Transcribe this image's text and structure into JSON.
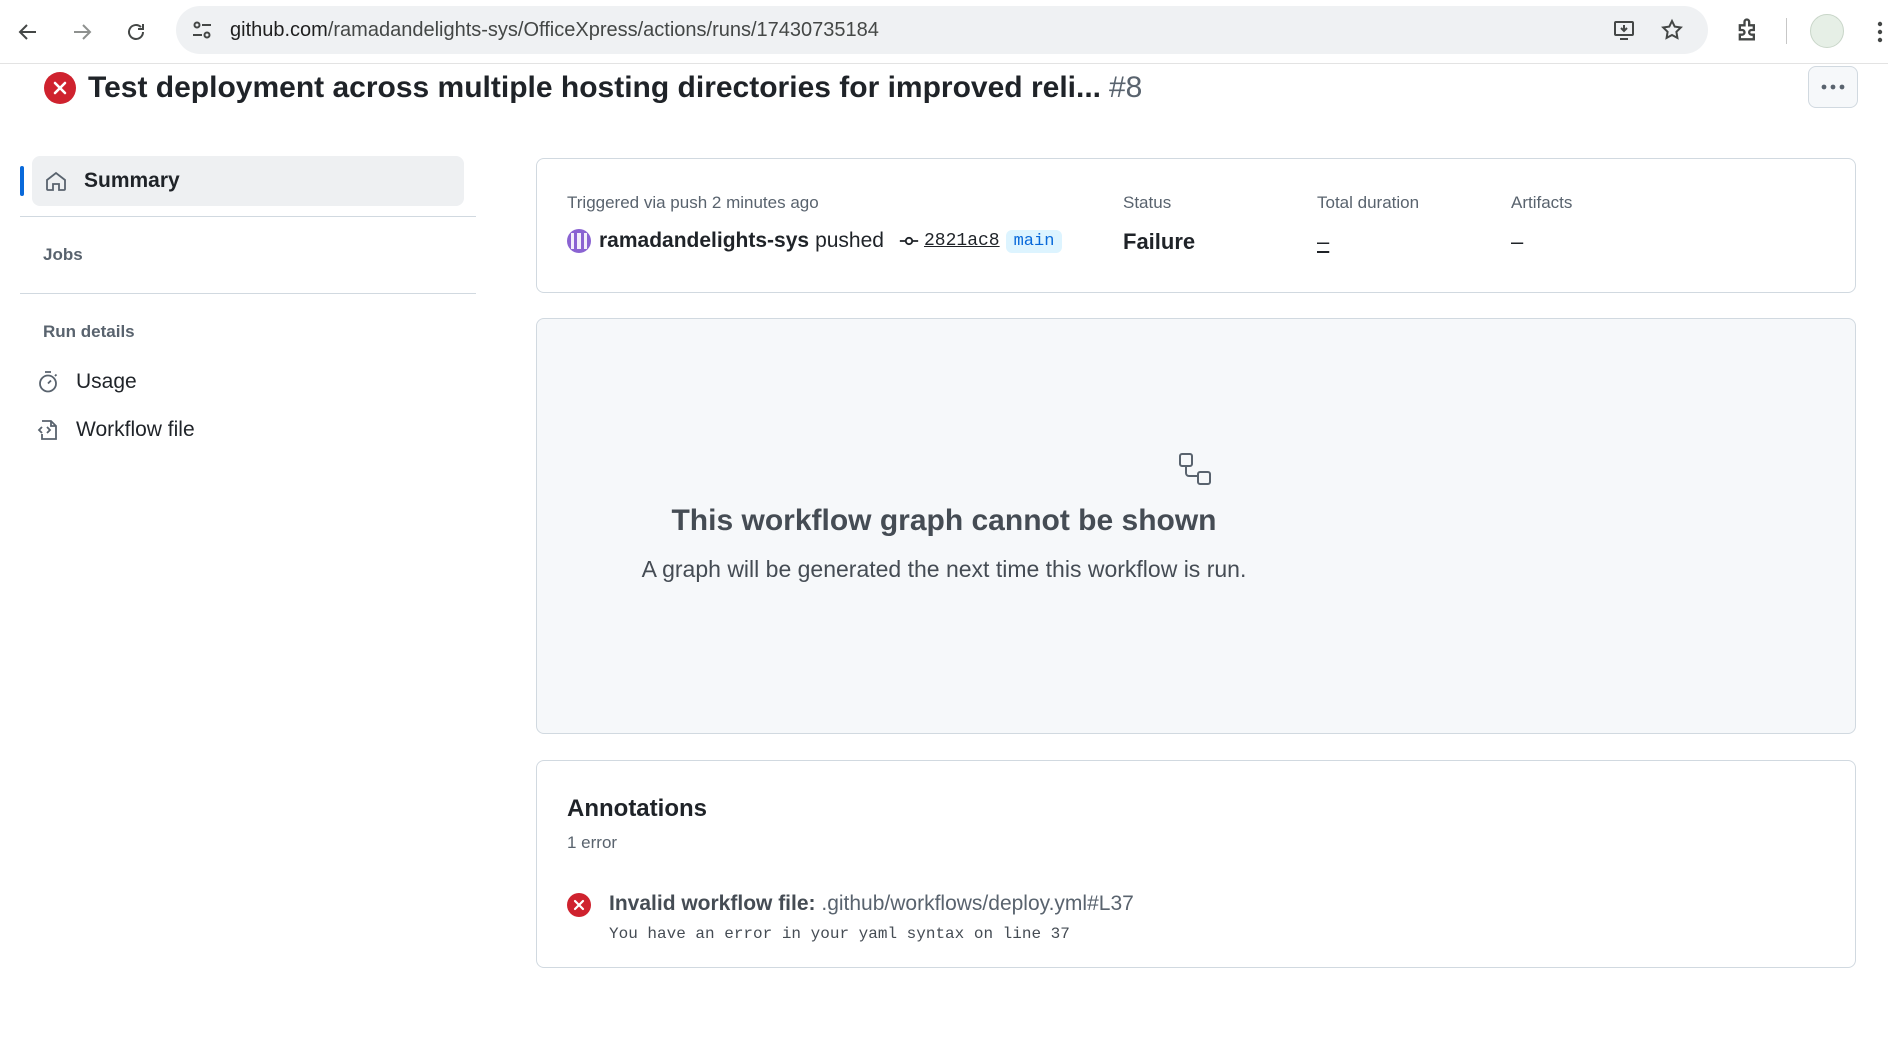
{
  "browser": {
    "url_host": "github.com",
    "url_path": "/ramadandelights-sys/OfficeXpress/actions/runs/17430735184"
  },
  "run": {
    "title": "Test deployment across multiple hosting directories for improved reli...",
    "number": "#8",
    "status_color": "#cf222e"
  },
  "sidebar": {
    "summary_label": "Summary",
    "jobs_section": "Jobs",
    "run_details_section": "Run details",
    "items": [
      {
        "label": "Usage",
        "icon": "stopwatch-icon"
      },
      {
        "label": "Workflow file",
        "icon": "file-code-icon"
      }
    ]
  },
  "summary": {
    "trigger_text": "Triggered via push 2 minutes ago",
    "pusher": "ramadandelights-sys",
    "verb": "pushed",
    "commit_sha": "2821ac8",
    "branch": "main",
    "status_label": "Status",
    "status_value": "Failure",
    "duration_label": "Total duration",
    "duration_value": "–",
    "artifacts_label": "Artifacts",
    "artifacts_value": "–"
  },
  "graph": {
    "title": "This workflow graph cannot be shown",
    "subtitle": "A graph will be generated the next time this workflow is run."
  },
  "annotations": {
    "title": "Annotations",
    "count": "1 error",
    "items": [
      {
        "heading": "Invalid workflow file:",
        "path": " .github/workflows/deploy.yml#L37",
        "message": "You have an error in your yaml syntax on line 37"
      }
    ]
  }
}
